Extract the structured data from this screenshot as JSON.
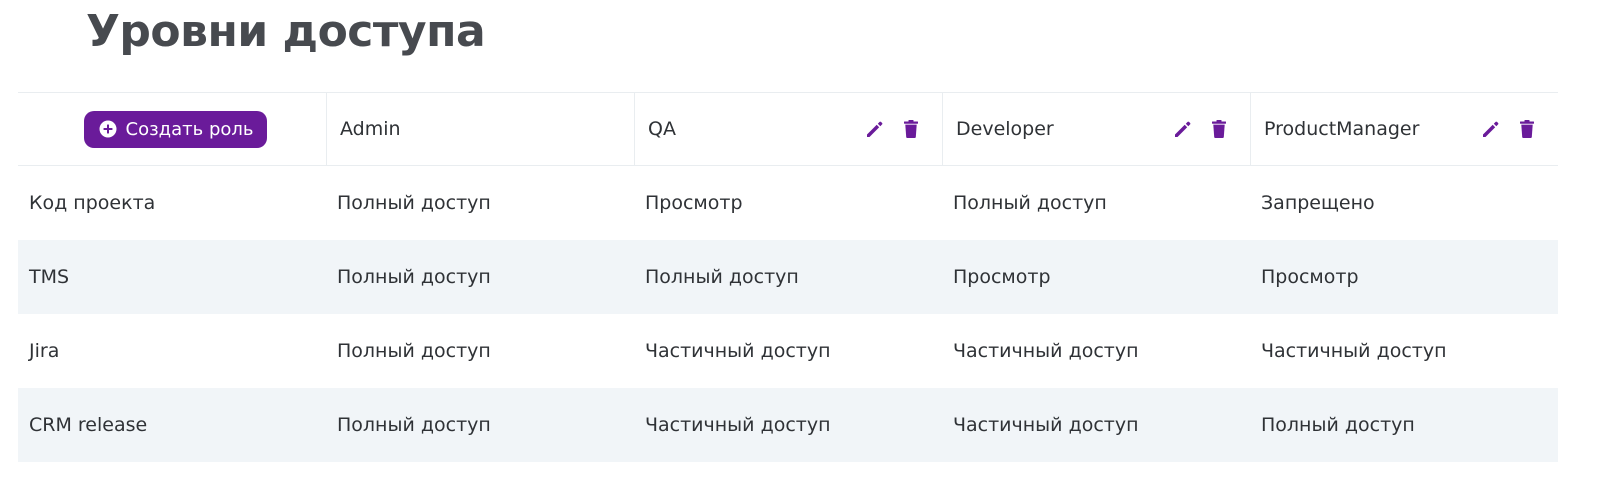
{
  "page": {
    "title": "Уровни доступа"
  },
  "colors": {
    "accent": "#6a1b9a",
    "row_shade": "#f1f5f8",
    "grid_line": "#e9edf0",
    "text": "#2f3236"
  },
  "toolbar": {
    "create_role_label": "Создать роль",
    "create_role_icon": "plus-circle-icon"
  },
  "roles": [
    {
      "name": "Admin",
      "editable": false
    },
    {
      "name": "QA",
      "editable": true
    },
    {
      "name": "Developer",
      "editable": true
    },
    {
      "name": "ProductManager",
      "editable": true
    }
  ],
  "role_action_icons": [
    "pencil-icon",
    "trash-icon"
  ],
  "rows": [
    {
      "resource": "Код проекта",
      "access": [
        "Полный доступ",
        "Просмотр",
        "Полный доступ",
        "Запрещено"
      ]
    },
    {
      "resource": "TMS",
      "access": [
        "Полный доступ",
        "Полный доступ",
        "Просмотр",
        "Просмотр"
      ]
    },
    {
      "resource": "Jira",
      "access": [
        "Полный доступ",
        "Частичный доступ",
        "Частичный доступ",
        "Частичный доступ"
      ]
    },
    {
      "resource": "CRM release",
      "access": [
        "Полный доступ",
        "Частичный доступ",
        "Частичный доступ",
        "Полный доступ"
      ]
    }
  ]
}
